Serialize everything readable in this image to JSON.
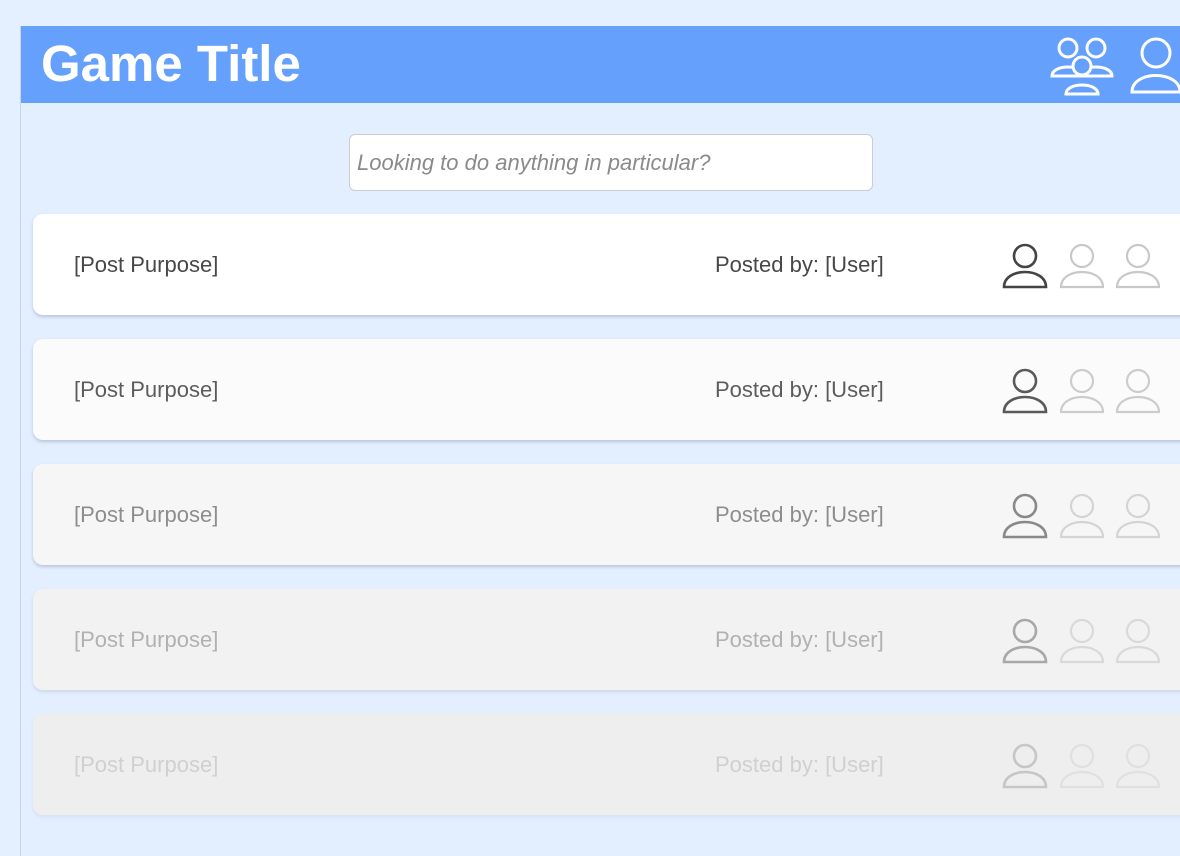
{
  "header": {
    "title": "Game Title",
    "group_icon": "group-icon",
    "profile_icon": "user-icon",
    "background_color": "#64a0fc"
  },
  "search": {
    "placeholder": "Looking to do anything in particular?",
    "value": ""
  },
  "posts": [
    {
      "purpose": "[Post Purpose]",
      "posted_by": "Posted by: [User]",
      "filled_slots": 1,
      "total_slots": 3
    },
    {
      "purpose": "[Post Purpose]",
      "posted_by": "Posted by: [User]",
      "filled_slots": 1,
      "total_slots": 3
    },
    {
      "purpose": "[Post Purpose]",
      "posted_by": "Posted by: [User]",
      "filled_slots": 1,
      "total_slots": 3
    },
    {
      "purpose": "[Post Purpose]",
      "posted_by": "Posted by: [User]",
      "filled_slots": 1,
      "total_slots": 3
    },
    {
      "purpose": "[Post Purpose]",
      "posted_by": "Posted by: [User]",
      "filled_slots": 1,
      "total_slots": 3
    }
  ],
  "colors": {
    "page_background": "#e3eeff",
    "filled_slot": "#444444",
    "empty_slot": "#c8c8c8"
  }
}
